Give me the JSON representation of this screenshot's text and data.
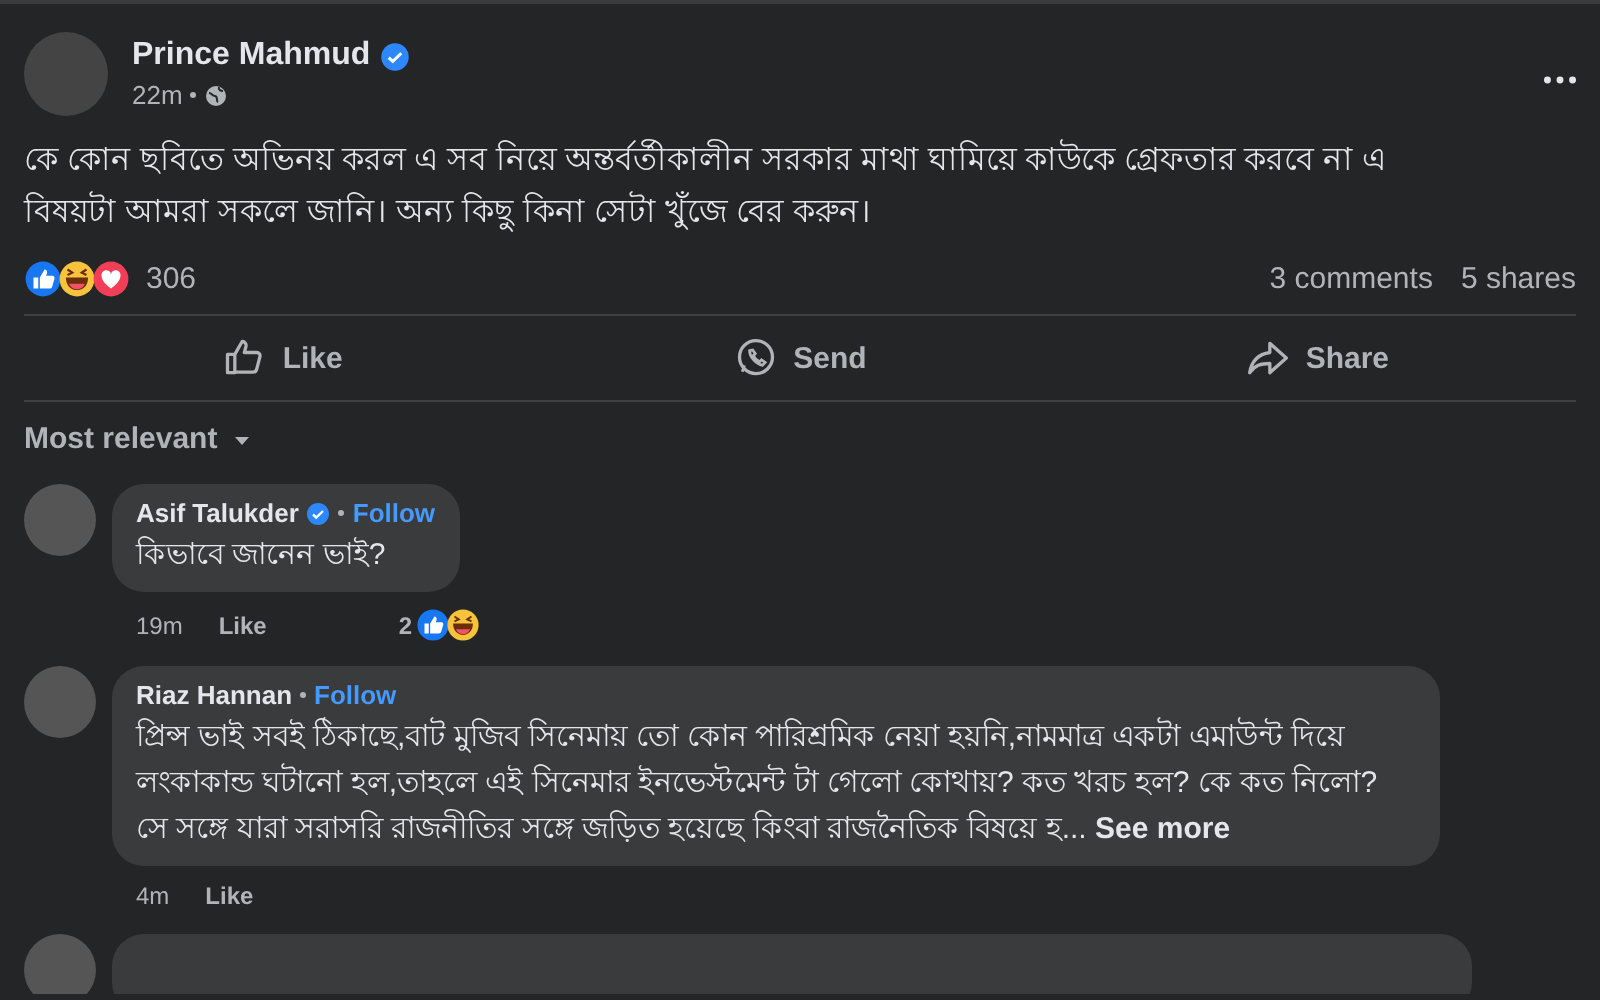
{
  "post": {
    "author": "Prince Mahmud",
    "verified": true,
    "time": "22m",
    "text": "কে কোন ছবিতে অভিনয় করল এ সব নিয়ে অন্তর্বর্তীকালীন সরকার মাথা ঘামিয়ে কাউকে গ্রেফতার করবে না এ বিষয়টা আমরা সকলে জানি। অন্য কিছু কিনা সেটা খুঁজে বের করুন।",
    "reaction_count": "306",
    "comments_count": "3 comments",
    "shares_count": "5 shares"
  },
  "actions": [
    {
      "kind": "like",
      "label": "Like"
    },
    {
      "kind": "send",
      "label": "Send"
    },
    {
      "kind": "share",
      "label": "Share"
    }
  ],
  "sort": {
    "label": "Most relevant"
  },
  "comments": [
    {
      "author": "Asif Talukder",
      "verified": true,
      "follow": "Follow",
      "text": "কিভাবে জানেন ভাই?",
      "time": "19m",
      "like": "Like",
      "reaction_count": "2"
    },
    {
      "author": "Riaz Hannan",
      "verified": false,
      "follow": "Follow",
      "text": "প্রিন্স ভাই সবই ঠিকাছে,বাট মুজিব সিনেমায় তো কোন পারিশ্রমিক নেয়া হয়নি,নামমাত্র একটা এমাউন্ট দিয়ে লংকাকান্ড ঘটানো হল,তাহলে এই সিনেমার ইনভেস্টমেন্ট টা গেলো কোথায়? কত খরচ হল? কে কত নিলো? সে সঙ্গে যারা সরাসরি রাজনীতির সঙ্গে জড়িত হয়েছে কিংবা রাজনৈতিক বিষয়ে হ...",
      "see_more": "See more",
      "time": "4m",
      "like": "Like"
    }
  ]
}
